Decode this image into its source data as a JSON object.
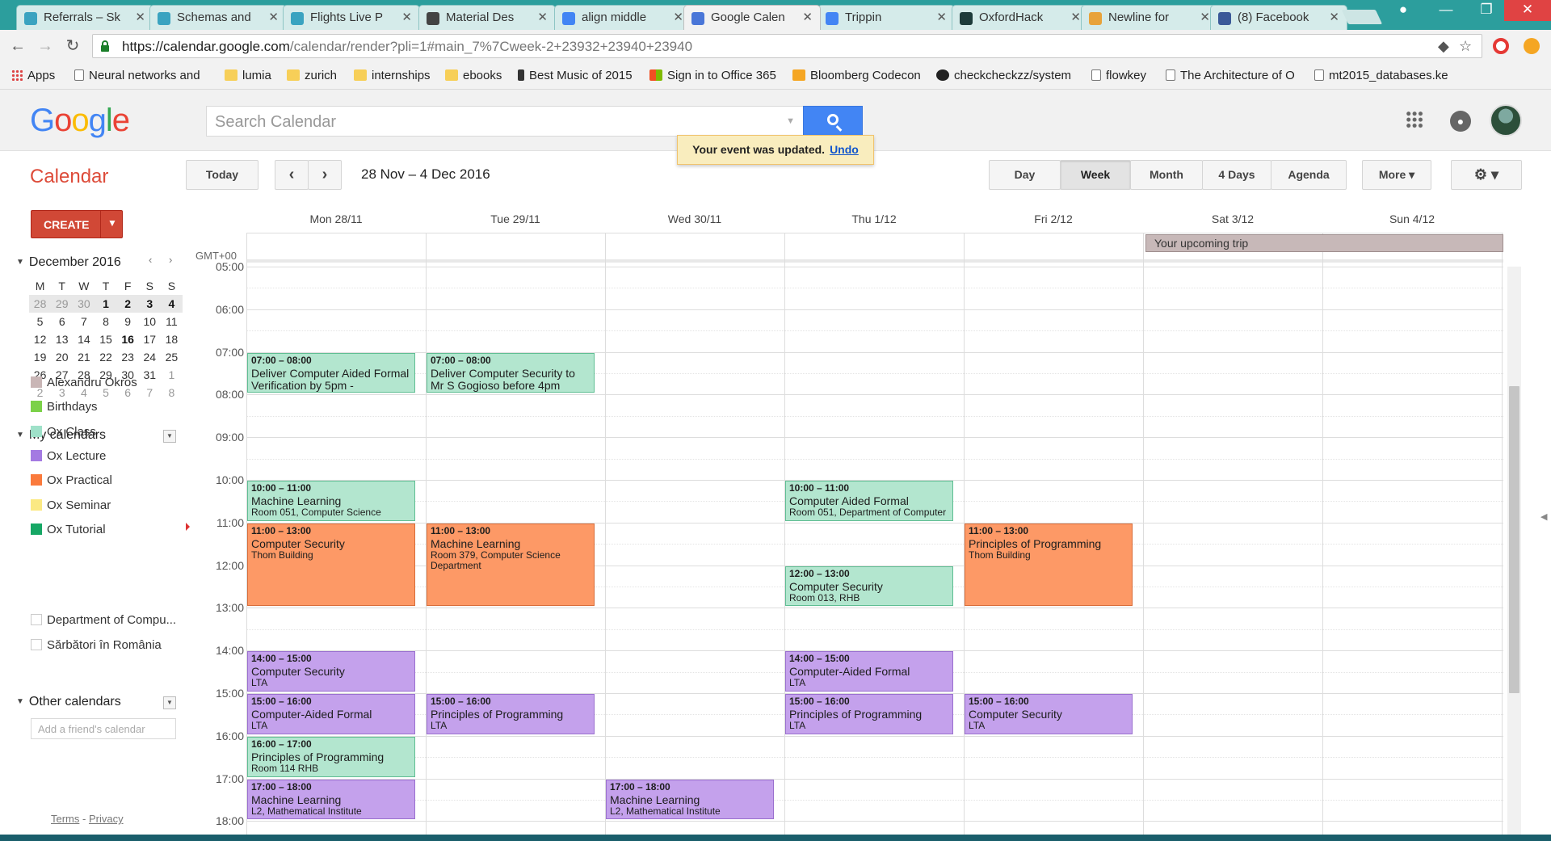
{
  "browser": {
    "tabs": [
      {
        "title": "Referrals – Sk",
        "favicon": "#3aa3c0"
      },
      {
        "title": "Schemas and",
        "favicon": "#3aa3c0"
      },
      {
        "title": "Flights Live P",
        "favicon": "#3aa3c0"
      },
      {
        "title": "Material Des",
        "favicon": "#444444"
      },
      {
        "title": "align middle",
        "favicon": "#4285f4"
      },
      {
        "title": "Google Calen",
        "favicon": "#4a76d8"
      },
      {
        "title": "Trippin",
        "favicon": "#4285f4"
      },
      {
        "title": "OxfordHack",
        "favicon": "#1d3b3a"
      },
      {
        "title": "Newline for",
        "favicon": "#e8a33b"
      },
      {
        "title": "(8) Facebook",
        "favicon": "#3b5998"
      }
    ],
    "url_main": "https://calendar.google.com",
    "url_rest": "/calendar/render?pli=1#main_7%7Cweek-2+23932+23940+23940",
    "bookmarks": [
      {
        "label": "Apps",
        "icon": "apps-grid-icon"
      },
      {
        "label": "Neural networks and",
        "icon": "page-icon"
      },
      {
        "label": "lumia",
        "icon": "folder-icon"
      },
      {
        "label": "zurich",
        "icon": "folder-icon"
      },
      {
        "label": "internships",
        "icon": "folder-icon"
      },
      {
        "label": "ebooks",
        "icon": "folder-icon"
      },
      {
        "label": "Best Music of 2015",
        "icon": "music-icon"
      },
      {
        "label": "Sign in to Office 365",
        "icon": "windows-icon"
      },
      {
        "label": "Bloomberg Codecon",
        "icon": "bloomberg-icon"
      },
      {
        "label": "checkcheckzz/system",
        "icon": "github-icon"
      },
      {
        "label": "flowkey",
        "icon": "page-icon"
      },
      {
        "label": "The Architecture of O",
        "icon": "page-icon"
      },
      {
        "label": "mt2015_databases.ke",
        "icon": "page-icon"
      }
    ]
  },
  "header": {
    "search_placeholder": "Search Calendar",
    "toast_text": "Your event was updated.",
    "toast_action": "Undo"
  },
  "toolbar": {
    "app_title": "Calendar",
    "today": "Today",
    "date_range": "28 Nov – 4 Dec 2016",
    "views": [
      "Day",
      "Week",
      "Month",
      "4 Days",
      "Agenda"
    ],
    "selected_view": "Week",
    "more": "More ▾",
    "settings": "⚙ ▾"
  },
  "sidebar": {
    "create": "CREATE",
    "month_title": "December 2016",
    "weekday_initials": [
      "M",
      "T",
      "W",
      "T",
      "F",
      "S",
      "S"
    ],
    "weeks": [
      [
        "28",
        "29",
        "30",
        "1",
        "2",
        "3",
        "4"
      ],
      [
        "5",
        "6",
        "7",
        "8",
        "9",
        "10",
        "11"
      ],
      [
        "12",
        "13",
        "14",
        "15",
        "16",
        "17",
        "18"
      ],
      [
        "19",
        "20",
        "21",
        "22",
        "23",
        "24",
        "25"
      ],
      [
        "26",
        "27",
        "28",
        "29",
        "30",
        "31",
        "1"
      ],
      [
        "2",
        "3",
        "4",
        "5",
        "6",
        "7",
        "8"
      ]
    ],
    "my_calendars_title": "My calendars",
    "my_calendars": [
      {
        "name": "Alexandru Okros",
        "color": "#c9b6b6"
      },
      {
        "name": "Birthdays",
        "color": "#7bd148"
      },
      {
        "name": "Ox Class",
        "color": "#9fe1c9"
      },
      {
        "name": "Ox Lecture",
        "color": "#a47ae2"
      },
      {
        "name": "Ox Practical",
        "color": "#fa7a3c"
      },
      {
        "name": "Ox Seminar",
        "color": "#fbe983"
      },
      {
        "name": "Ox Tutorial",
        "color": "#16a765"
      }
    ],
    "other_calendars_title": "Other calendars",
    "friend_placeholder": "Add a friend's calendar",
    "other_calendars": [
      {
        "name": "Department of Compu..."
      },
      {
        "name": "Sărbători în România"
      }
    ],
    "terms": "Terms",
    "privacy": "Privacy"
  },
  "grid": {
    "timezone": "GMT+00",
    "days": [
      "Mon 28/11",
      "Tue 29/11",
      "Wed 30/11",
      "Thu 1/12",
      "Fri 2/12",
      "Sat 3/12",
      "Sun 4/12"
    ],
    "hours": [
      "05:00",
      "06:00",
      "07:00",
      "08:00",
      "09:00",
      "10:00",
      "11:00",
      "12:00",
      "13:00",
      "14:00",
      "15:00",
      "16:00",
      "17:00",
      "18:00"
    ],
    "all_day_event": "Your upcoming trip",
    "events": [
      {
        "day": 0,
        "start": 7,
        "end": 8,
        "time": "07:00 – 08:00",
        "title": "Deliver Computer Aided Formal Verification by 5pm -",
        "location": "",
        "kind": "class"
      },
      {
        "day": 1,
        "start": 7,
        "end": 8,
        "time": "07:00 – 08:00",
        "title": "Deliver Computer Security to Mr S Gogioso before 4pm",
        "location": "",
        "kind": "class"
      },
      {
        "day": 0,
        "start": 10,
        "end": 11,
        "time": "10:00 – 11:00",
        "title": "Machine Learning",
        "location": "Room 051, Computer Science",
        "kind": "class"
      },
      {
        "day": 3,
        "start": 10,
        "end": 11,
        "time": "10:00 – 11:00",
        "title": "Computer Aided Formal",
        "location": "Room 051, Department of Computer",
        "kind": "class"
      },
      {
        "day": 0,
        "start": 11,
        "end": 13,
        "time": "11:00 – 13:00",
        "title": "Computer Security",
        "location": "Thom Building",
        "kind": "practical"
      },
      {
        "day": 1,
        "start": 11,
        "end": 13,
        "time": "11:00 – 13:00",
        "title": "Machine Learning",
        "location": "Room 379, Computer Science Department",
        "kind": "practical"
      },
      {
        "day": 4,
        "start": 11,
        "end": 13,
        "time": "11:00 – 13:00",
        "title": "Principles of Programming",
        "location": "Thom Building",
        "kind": "practical"
      },
      {
        "day": 3,
        "start": 12,
        "end": 13,
        "time": "12:00 – 13:00",
        "title": "Computer Security",
        "location": "Room 013, RHB",
        "kind": "class"
      },
      {
        "day": 0,
        "start": 14,
        "end": 15,
        "time": "14:00 – 15:00",
        "title": "Computer Security",
        "location": "LTA",
        "kind": "lecture"
      },
      {
        "day": 3,
        "start": 14,
        "end": 15,
        "time": "14:00 – 15:00",
        "title": "Computer-Aided Formal",
        "location": "LTA",
        "kind": "lecture"
      },
      {
        "day": 0,
        "start": 15,
        "end": 16,
        "time": "15:00 – 16:00",
        "title": "Computer-Aided Formal",
        "location": "LTA",
        "kind": "lecture"
      },
      {
        "day": 1,
        "start": 15,
        "end": 16,
        "time": "15:00 – 16:00",
        "title": "Principles of Programming",
        "location": "LTA",
        "kind": "lecture"
      },
      {
        "day": 3,
        "start": 15,
        "end": 16,
        "time": "15:00 – 16:00",
        "title": "Principles of Programming",
        "location": "LTA",
        "kind": "lecture"
      },
      {
        "day": 4,
        "start": 15,
        "end": 16,
        "time": "15:00 – 16:00",
        "title": "Computer Security",
        "location": "LTA",
        "kind": "lecture"
      },
      {
        "day": 0,
        "start": 16,
        "end": 17,
        "time": "16:00 – 17:00",
        "title": "Principles of Programming",
        "location": "Room 114 RHB",
        "kind": "class"
      },
      {
        "day": 0,
        "start": 17,
        "end": 18,
        "time": "17:00 – 18:00",
        "title": "Machine Learning",
        "location": "L2, Mathematical Institute",
        "kind": "lecture"
      },
      {
        "day": 2,
        "start": 17,
        "end": 18,
        "time": "17:00 – 18:00",
        "title": "Machine Learning",
        "location": "L2, Mathematical Institute",
        "kind": "lecture"
      }
    ]
  }
}
